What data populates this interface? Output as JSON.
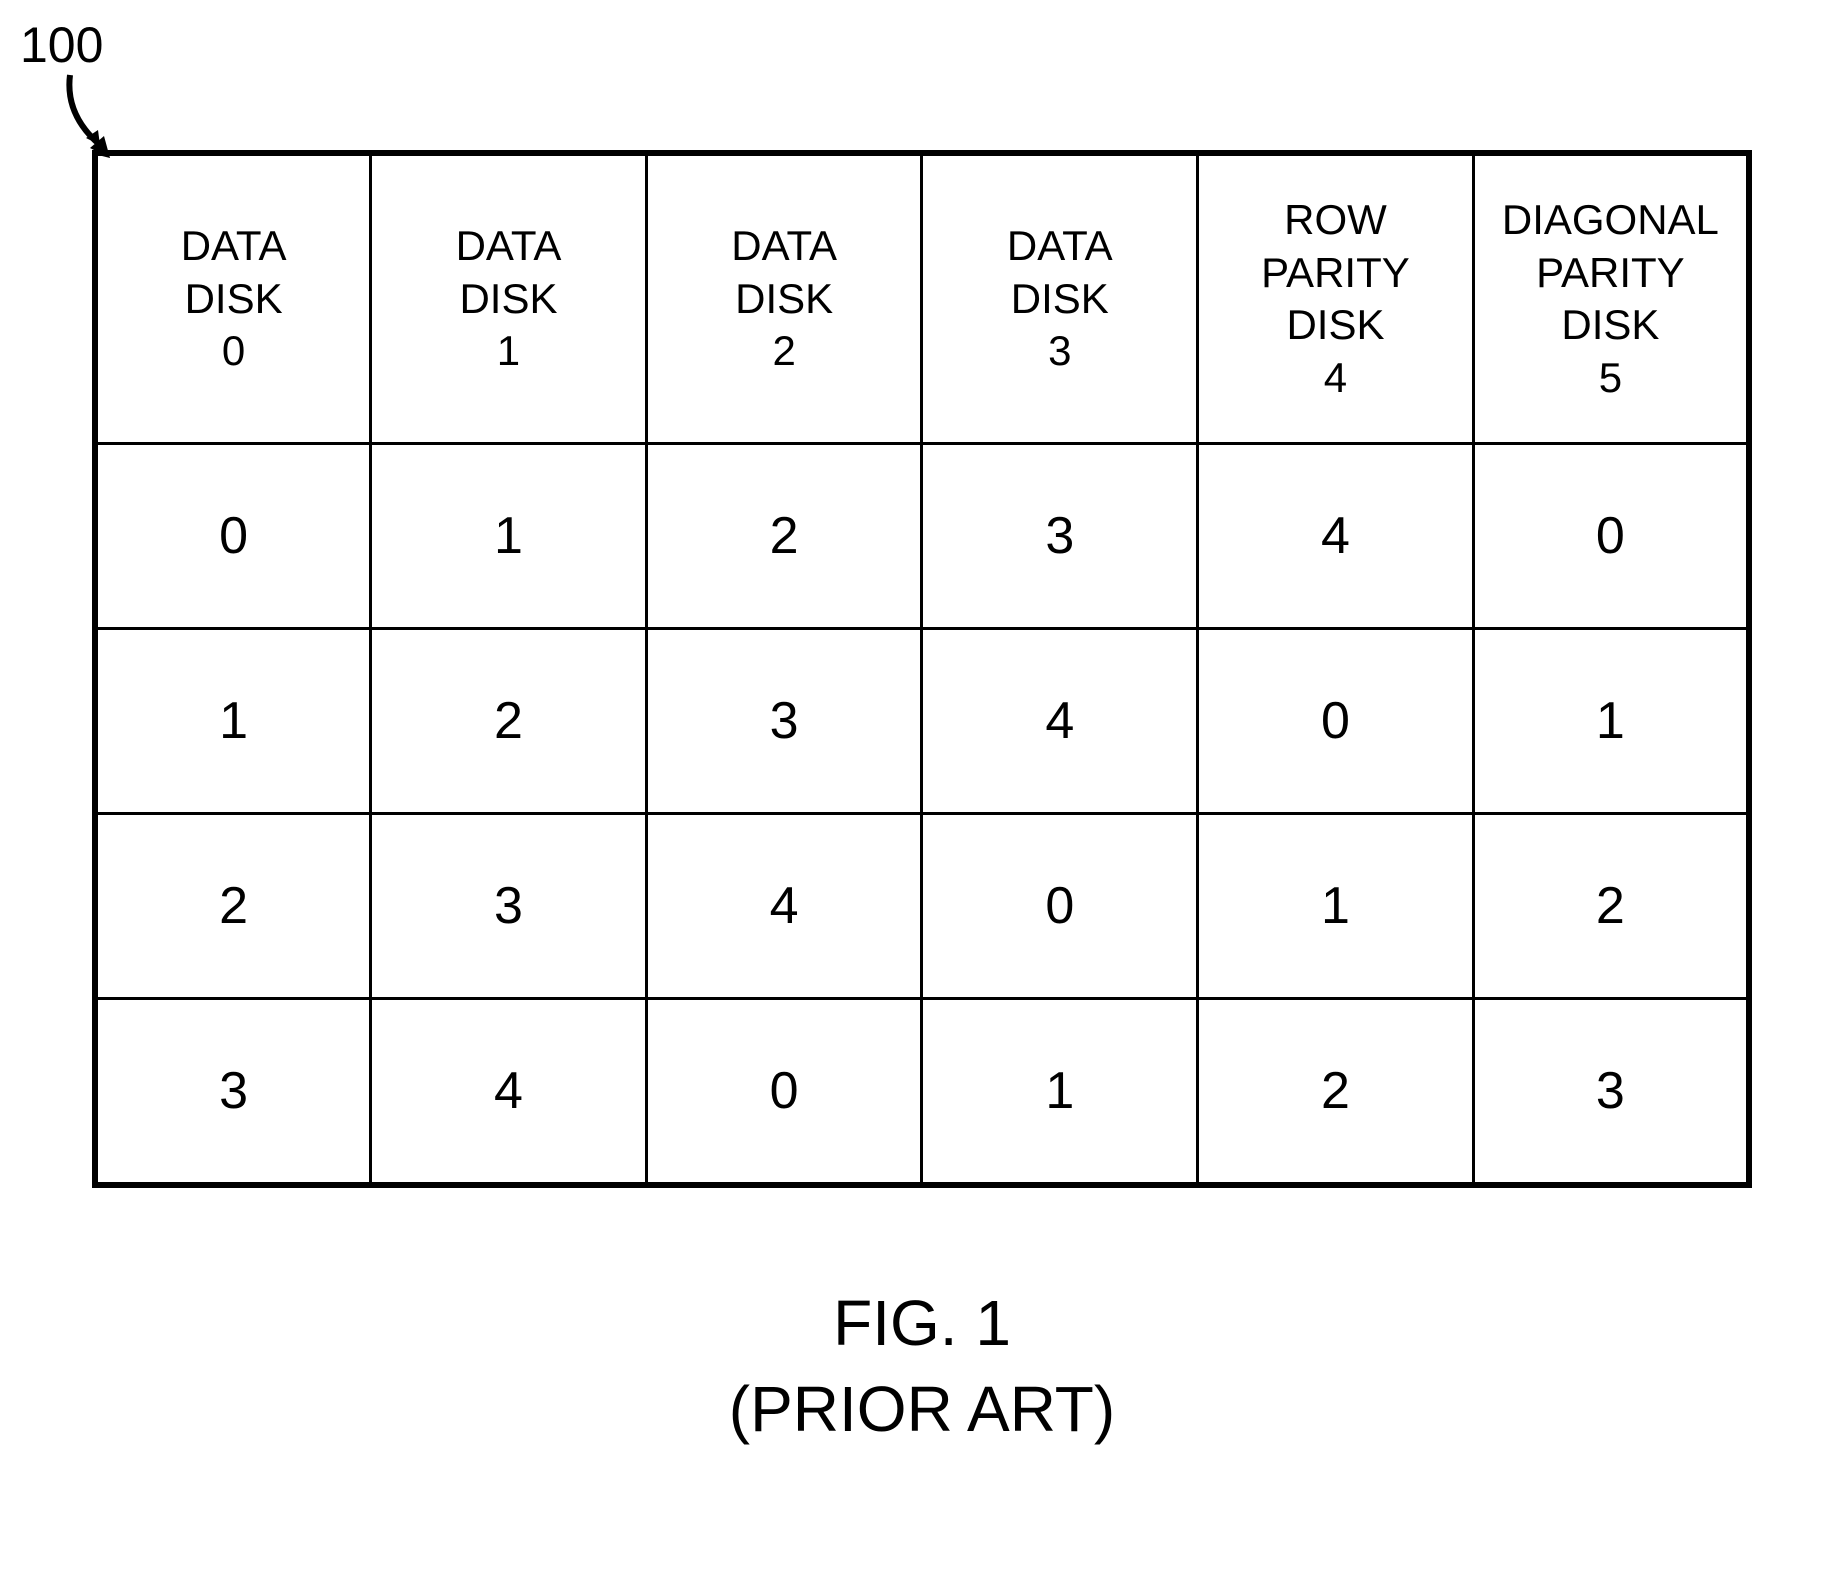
{
  "reference_number": "100",
  "caption_line1": "FIG. 1",
  "caption_line2": "(PRIOR ART)",
  "headers": [
    "DATA\nDISK\n0",
    "DATA\nDISK\n1",
    "DATA\nDISK\n2",
    "DATA\nDISK\n3",
    "ROW\nPARITY\nDISK\n4",
    "DIAGONAL\nPARITY\nDISK\n5"
  ],
  "rows": [
    [
      "0",
      "1",
      "2",
      "3",
      "4",
      "0"
    ],
    [
      "1",
      "2",
      "3",
      "4",
      "0",
      "1"
    ],
    [
      "2",
      "3",
      "4",
      "0",
      "1",
      "2"
    ],
    [
      "3",
      "4",
      "0",
      "1",
      "2",
      "3"
    ]
  ],
  "chart_data": {
    "type": "table",
    "title": "FIG. 1 (PRIOR ART)",
    "columns": [
      "DATA DISK 0",
      "DATA DISK 1",
      "DATA DISK 2",
      "DATA DISK 3",
      "ROW PARITY DISK 4",
      "DIAGONAL PARITY DISK 5"
    ],
    "data": [
      [
        0,
        1,
        2,
        3,
        4,
        0
      ],
      [
        1,
        2,
        3,
        4,
        0,
        1
      ],
      [
        2,
        3,
        4,
        0,
        1,
        2
      ],
      [
        3,
        4,
        0,
        1,
        2,
        3
      ]
    ]
  }
}
